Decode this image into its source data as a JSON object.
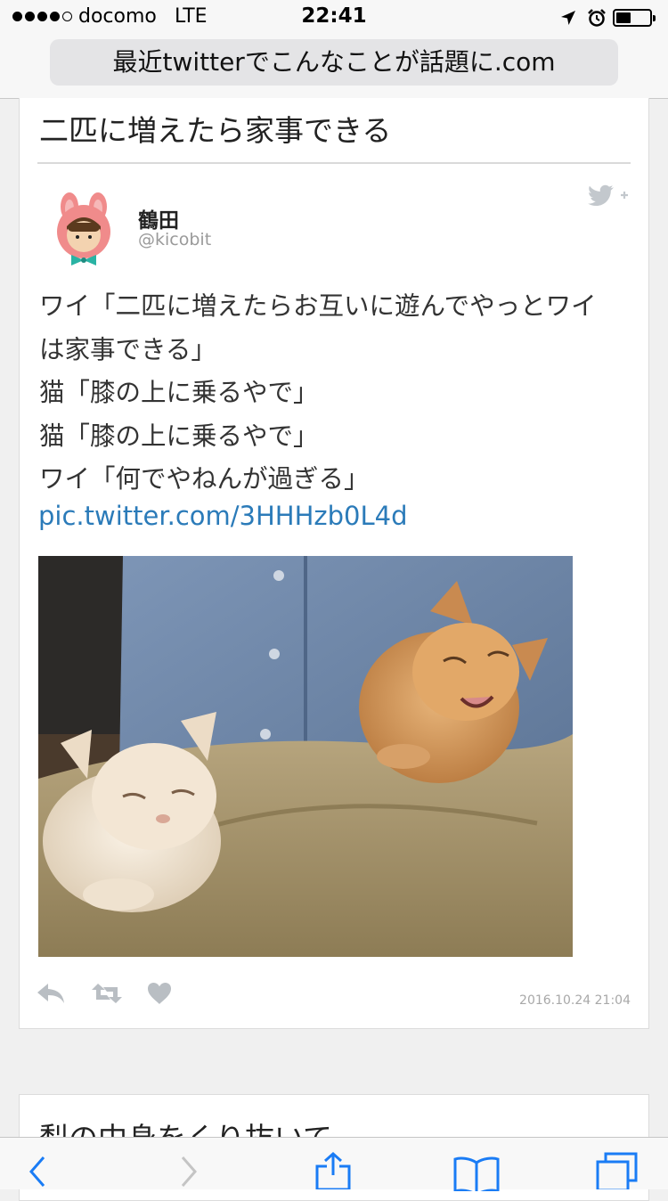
{
  "status_bar": {
    "carrier": "docomo",
    "network": "LTE",
    "time": "22:41",
    "signal_bars_filled": 4,
    "signal_bars_total": 5,
    "icons": [
      "location-arrow-icon",
      "alarm-clock-icon",
      "battery-icon"
    ]
  },
  "browser": {
    "url_text": "最近twitterでこんなことが話題に.com",
    "toolbar_icons": [
      "back-icon",
      "forward-icon",
      "share-icon",
      "bookmarks-icon",
      "tabs-icon"
    ]
  },
  "article": {
    "title": "二匹に増えたら家事できる",
    "tweet": {
      "author_name": "鶴田",
      "author_handle": "@kicobit",
      "text_lines": [
        "ワイ「二匹に増えたらお互いに遊んでやっとワイ",
        "は家事できる」",
        "猫「膝の上に乗るやで」",
        "猫「膝の上に乗るやで」",
        "ワイ「何でやねんが過ぎる」"
      ],
      "link": "pic.twitter.com/3HHHzb0L4d",
      "timestamp": "2016.10.24 21:04",
      "photo_subject": "two kittens on a lap",
      "actions": [
        "reply-icon",
        "retweet-icon",
        "like-icon"
      ]
    }
  },
  "next_article": {
    "title": "梨の中身をくり抜いて"
  },
  "colors": {
    "link": "#2b7bb9",
    "ios_blue": "#1a7cf5",
    "muted": "#9a9a9a"
  }
}
